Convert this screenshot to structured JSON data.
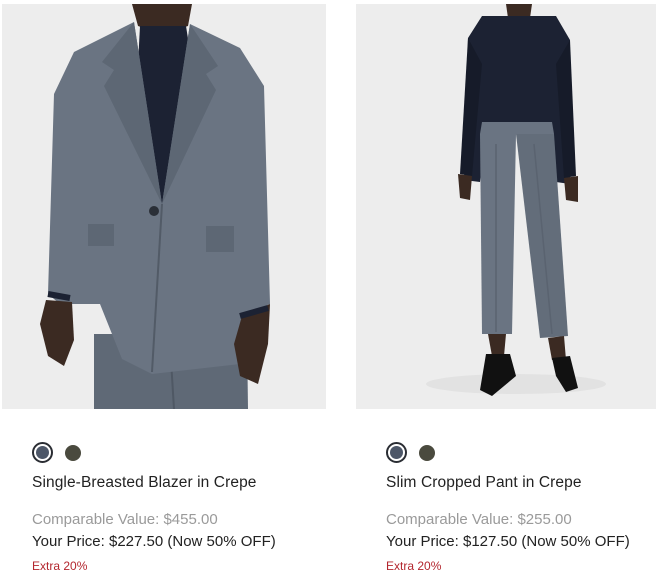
{
  "products": [
    {
      "name": "Single-Breasted Blazer in Crepe",
      "comparable_value": "Comparable Value: $455.00",
      "your_price": "Your Price: $227.50 (Now 50% OFF)",
      "extra": "Extra 20%",
      "swatches": [
        {
          "color": "#4d5768",
          "selected": true
        },
        {
          "color": "#4a4a3e",
          "selected": false
        }
      ]
    },
    {
      "name": "Slim Cropped Pant in Crepe",
      "comparable_value": "Comparable Value: $255.00",
      "your_price": "Your Price: $127.50 (Now 50% OFF)",
      "extra": "Extra 20%",
      "swatches": [
        {
          "color": "#4d5768",
          "selected": true
        },
        {
          "color": "#4a4a3e",
          "selected": false
        }
      ]
    }
  ],
  "colors": {
    "image_background": "#ededed",
    "garment_gray": "#6a7482",
    "shirt_navy": "#1c2233",
    "skin": "#3b2a22",
    "extra_red": "#b3262e",
    "muted_text": "#9a9a9a"
  }
}
